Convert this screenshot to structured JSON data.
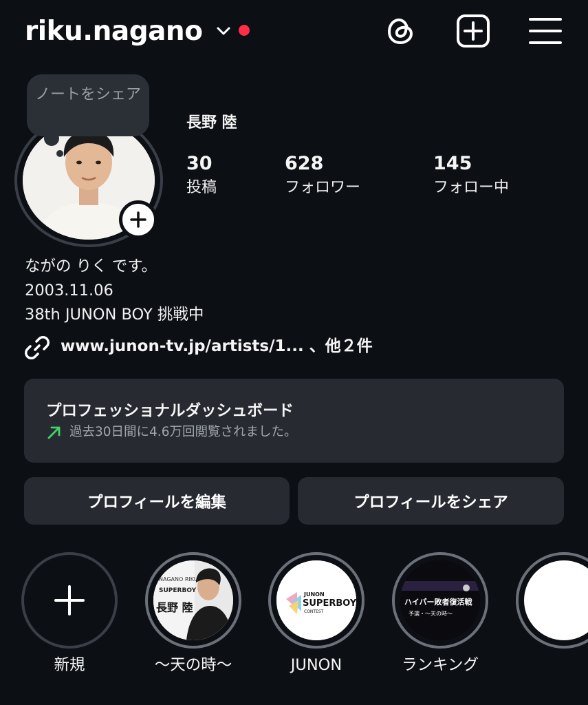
{
  "header": {
    "username": "riku.nagano",
    "icons": [
      "chevron-down-icon",
      "notification-dot",
      "threads-icon",
      "new-post-icon",
      "menu-icon"
    ],
    "accent_dot_color": "#ff2d48"
  },
  "note": {
    "text": "ノートをシェア"
  },
  "profile": {
    "full_name": "長野 陸",
    "stats": [
      {
        "value": "30",
        "label": "投稿"
      },
      {
        "value": "628",
        "label": "フォロワー"
      },
      {
        "value": "145",
        "label": "フォロー中"
      }
    ]
  },
  "bio": {
    "lines": [
      "ながの りく です。",
      "2003.11.06",
      "38th JUNON BOY 挑戦中"
    ],
    "link": "www.junon-tv.jp/artists/1... 、他２件"
  },
  "dashboard": {
    "title": "プロフェッショナルダッシュボード",
    "subtitle": "過去30日間に4.6万回閲覧されました。",
    "trend_color": "#3ed46a"
  },
  "buttons": {
    "edit": "プロフィールを編集",
    "share": "プロフィールをシェア"
  },
  "highlights": [
    {
      "label": "新規"
    },
    {
      "label": "〜天の時〜"
    },
    {
      "label": "JUNON"
    },
    {
      "label": "ランキング"
    },
    {
      "label": ""
    }
  ],
  "highlight_art": {
    "tennotoki_top": "NAGANO RIKU",
    "tennotoki_brand": "SUPERBOY",
    "tennotoki_name": "長野 陸",
    "junon_small": "JUNON",
    "junon_big": "SUPERBOY",
    "junon_sub": "CONTEST",
    "ranking_title": "ハイパー敗者復活戦",
    "ranking_sub": "予選・〜天の時〜"
  }
}
